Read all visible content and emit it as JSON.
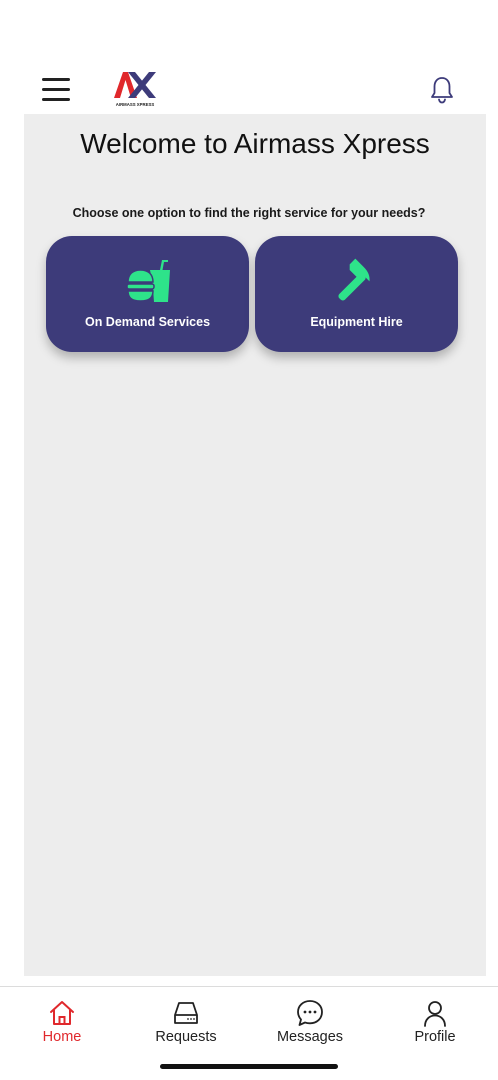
{
  "header": {
    "logo_text": "AIRMASS XPRESS"
  },
  "main": {
    "title": "Welcome to Airmass Xpress",
    "subtitle": "Choose one option to find the right service for your needs?",
    "options": [
      {
        "label": "On Demand Services",
        "icon": "food-drink-icon"
      },
      {
        "label": "Equipment Hire",
        "icon": "hammer-icon"
      }
    ]
  },
  "bottom_nav": {
    "items": [
      {
        "label": "Home",
        "icon": "home-icon",
        "active": true
      },
      {
        "label": "Requests",
        "icon": "inbox-icon",
        "active": false
      },
      {
        "label": "Messages",
        "icon": "chat-icon",
        "active": false
      },
      {
        "label": "Profile",
        "icon": "person-icon",
        "active": false
      }
    ]
  },
  "colors": {
    "accent": "#e0282c",
    "card": "#3d3b7a",
    "icon_green": "#2ee38a",
    "panel_bg": "#ededed"
  }
}
